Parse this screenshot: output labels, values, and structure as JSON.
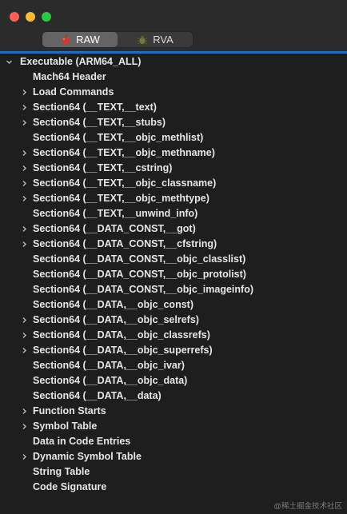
{
  "window": {
    "segments": [
      {
        "label": "RAW",
        "icon": "apple-icon",
        "active": true
      },
      {
        "label": "RVA",
        "icon": "bug-icon",
        "active": false
      }
    ]
  },
  "tree": {
    "root": {
      "label": "Executable  (ARM64_ALL)",
      "expanded": true
    },
    "items": [
      {
        "label": "Mach64 Header",
        "expandable": false
      },
      {
        "label": "Load Commands",
        "expandable": true
      },
      {
        "label": "Section64 (__TEXT,__text)",
        "expandable": true
      },
      {
        "label": "Section64 (__TEXT,__stubs)",
        "expandable": true
      },
      {
        "label": "Section64 (__TEXT,__objc_methlist)",
        "expandable": false
      },
      {
        "label": "Section64 (__TEXT,__objc_methname)",
        "expandable": true
      },
      {
        "label": "Section64 (__TEXT,__cstring)",
        "expandable": true
      },
      {
        "label": "Section64 (__TEXT,__objc_classname)",
        "expandable": true
      },
      {
        "label": "Section64 (__TEXT,__objc_methtype)",
        "expandable": true
      },
      {
        "label": "Section64 (__TEXT,__unwind_info)",
        "expandable": false
      },
      {
        "label": "Section64 (__DATA_CONST,__got)",
        "expandable": true
      },
      {
        "label": "Section64 (__DATA_CONST,__cfstring)",
        "expandable": true
      },
      {
        "label": "Section64 (__DATA_CONST,__objc_classlist)",
        "expandable": false
      },
      {
        "label": "Section64 (__DATA_CONST,__objc_protolist)",
        "expandable": false
      },
      {
        "label": "Section64 (__DATA_CONST,__objc_imageinfo)",
        "expandable": false
      },
      {
        "label": "Section64 (__DATA,__objc_const)",
        "expandable": false
      },
      {
        "label": "Section64 (__DATA,__objc_selrefs)",
        "expandable": true
      },
      {
        "label": "Section64 (__DATA,__objc_classrefs)",
        "expandable": true
      },
      {
        "label": "Section64 (__DATA,__objc_superrefs)",
        "expandable": true
      },
      {
        "label": "Section64 (__DATA,__objc_ivar)",
        "expandable": false
      },
      {
        "label": "Section64 (__DATA,__objc_data)",
        "expandable": false
      },
      {
        "label": "Section64 (__DATA,__data)",
        "expandable": false
      },
      {
        "label": "Function Starts",
        "expandable": true
      },
      {
        "label": "Symbol Table",
        "expandable": true
      },
      {
        "label": "Data in Code Entries",
        "expandable": false
      },
      {
        "label": "Dynamic Symbol Table",
        "expandable": true
      },
      {
        "label": "String Table",
        "expandable": false
      },
      {
        "label": "Code Signature",
        "expandable": false
      }
    ]
  },
  "watermark": "@稀土掘金技术社区",
  "colors": {
    "background": "#1e1e1e",
    "accent_line": "#1e6fbf",
    "close": "#fe5f57",
    "minimize": "#febc2e",
    "maximize": "#28c840"
  }
}
